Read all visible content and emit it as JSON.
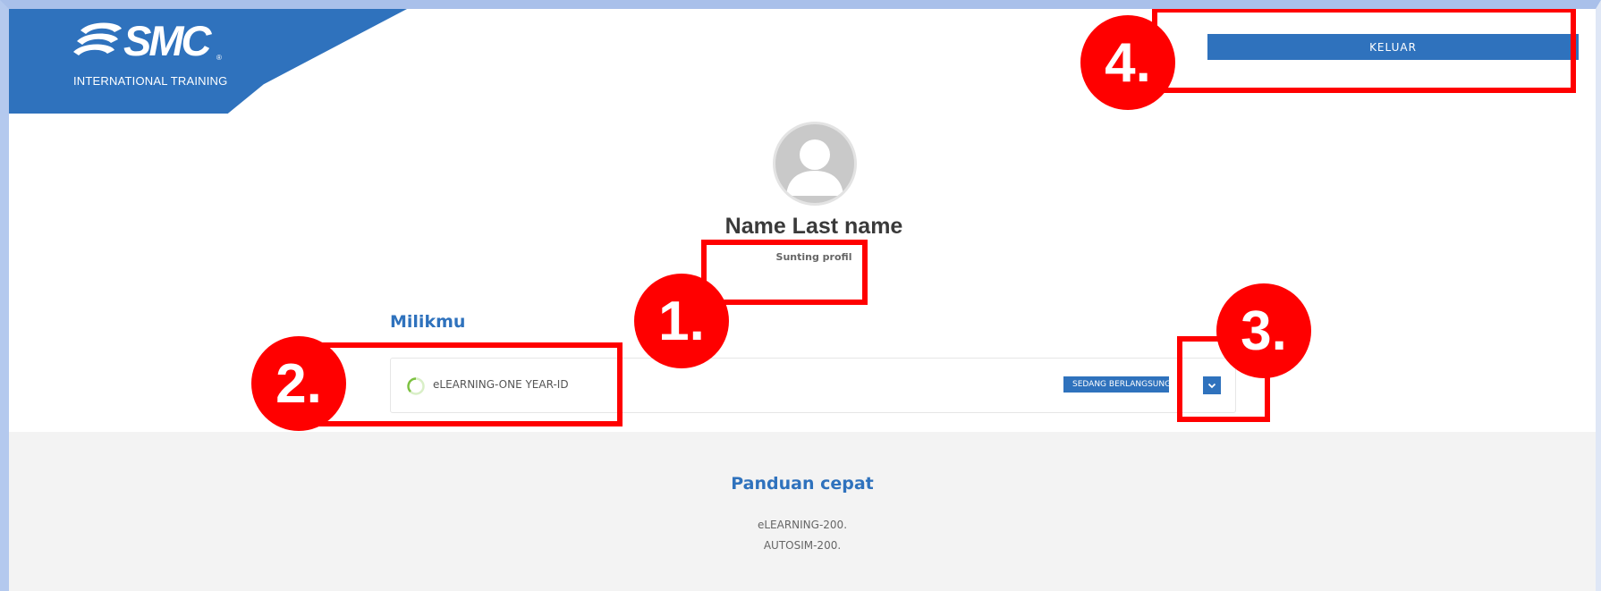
{
  "header": {
    "logo_text": "SMC",
    "logo_reg": "®",
    "logo_subtitle": "INTERNATIONAL TRAINING",
    "logout_label": "KELUAR"
  },
  "profile": {
    "name": "Name Last name",
    "edit_label": "Sunting profil"
  },
  "owned": {
    "title": "Milikmu",
    "courses": [
      {
        "name": "eLEARNING-ONE YEAR-ID",
        "status": "SEDANG BERLANGSUNG"
      }
    ]
  },
  "footer": {
    "title": "Panduan cepat",
    "links": [
      "eLEARNING-200.",
      "AUTOSIM-200."
    ]
  },
  "annotations": [
    "1.",
    "2.",
    "3.",
    "4."
  ],
  "colors": {
    "brand_blue": "#2f72bd",
    "annotation_red": "#ff0000",
    "progress_green": "#7dc142",
    "footer_bg": "#f3f3f3"
  }
}
